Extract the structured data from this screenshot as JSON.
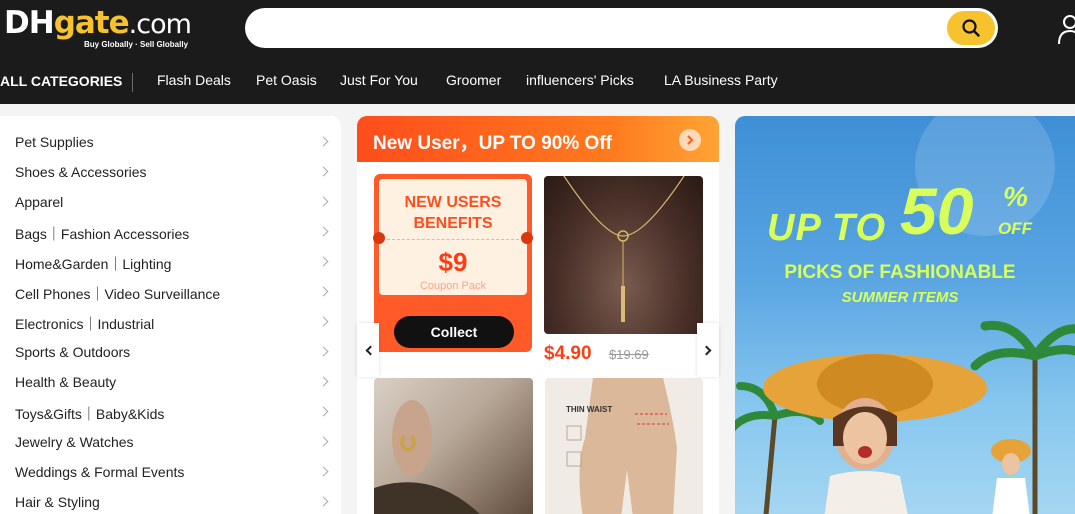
{
  "header": {
    "logo": {
      "brand_left": "DH",
      "brand_mid": "gate",
      "brand_right": ".com",
      "tagline": "Buy Globally · Sell Globally"
    },
    "search": {
      "value": "",
      "placeholder": ""
    },
    "icons": {
      "search": "search-icon",
      "account": "user-icon"
    }
  },
  "nav": {
    "all_categories": "ALL CATEGORIES",
    "items": [
      "Flash Deals",
      "Pet Oasis",
      "Just For You",
      "Groomer",
      "influencers' Picks",
      "LA Business Party"
    ]
  },
  "categories": [
    "Pet Supplies",
    "Shoes & Accessories",
    "Apparel",
    "Bags｜Fashion Accessories",
    "Home&Garden｜Lighting",
    "Cell Phones｜Video Surveillance",
    "Electronics｜Industrial",
    "Sports & Outdoors",
    "Health & Beauty",
    "Toys&Gifts｜Baby&Kids",
    "Jewelry & Watches",
    "Weddings & Formal Events",
    "Hair & Styling"
  ],
  "promo": {
    "title": "New User，UP TO 90% Off",
    "coupon": {
      "heading": "NEW USERS BENEFITS",
      "amount": "$9",
      "subtitle": "Coupon Pack",
      "button": "Collect"
    },
    "product": {
      "price": "$4.90",
      "original_price": "$19.69"
    },
    "shapewear_label": "THIN WAIST"
  },
  "banner": {
    "up_to": "UP TO",
    "percent": "50",
    "percent_sign": "%",
    "off": "OFF",
    "line1": "PICKS OF FASHIONABLE",
    "line2": "SUMMER ITEMS"
  },
  "colors": {
    "header_bg": "#1b1b1b",
    "brand_yellow": "#f6c22e",
    "promo_orange": "#ff5a28",
    "price_red": "#ff3e14",
    "banner_green": "#d8ff5a"
  }
}
